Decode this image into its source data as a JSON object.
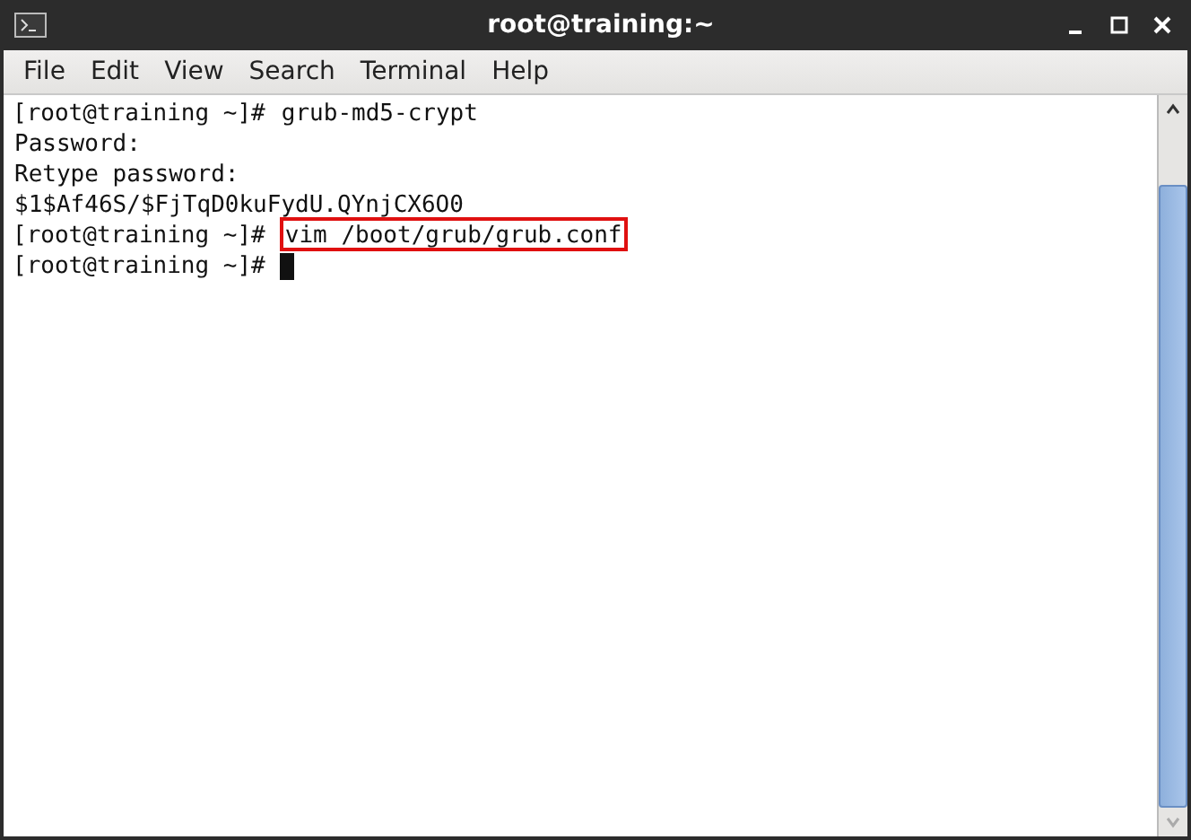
{
  "window": {
    "title": "root@training:~"
  },
  "menu": [
    "File",
    "Edit",
    "View",
    "Search",
    "Terminal",
    "Help"
  ],
  "terminal": {
    "lines": [
      {
        "prompt": "[root@training ~]#",
        "command": "grub-md5-crypt",
        "highlighted": false,
        "cursor": false
      },
      {
        "command": "Password:",
        "highlighted": false,
        "cursor": false
      },
      {
        "command": "Retype password:",
        "highlighted": false,
        "cursor": false
      },
      {
        "command": "$1$Af46S/$FjTqD0kuFydU.QYnjCX6O0",
        "highlighted": false,
        "cursor": false
      },
      {
        "prompt": "[root@training ~]#",
        "command": "vim /boot/grub/grub.conf",
        "highlighted": true,
        "cursor": false
      },
      {
        "prompt": "[root@training ~]#",
        "highlighted": false,
        "cursor": true
      }
    ]
  }
}
